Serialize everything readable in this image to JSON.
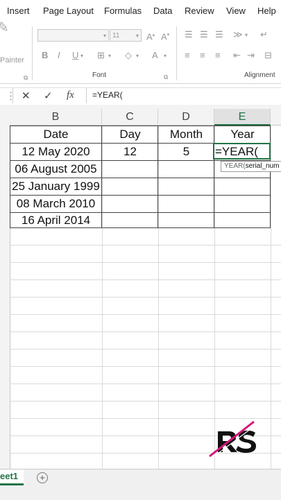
{
  "ribbon": {
    "tabs": [
      "Insert",
      "Page Layout",
      "Formulas",
      "Data",
      "Review",
      "View",
      "Help"
    ],
    "painter_label": "Painter",
    "font_size": "11",
    "group_font": "Font",
    "group_alignment": "Alignment",
    "bold": "B",
    "italic": "I",
    "underline": "U"
  },
  "formula_bar": {
    "cancel_icon": "✕",
    "enter_icon": "✓",
    "fx_label": "fx",
    "content": "=YEAR("
  },
  "columns": [
    {
      "letter": "B",
      "selected": false
    },
    {
      "letter": "C",
      "selected": false
    },
    {
      "letter": "D",
      "selected": false
    },
    {
      "letter": "E",
      "selected": true
    }
  ],
  "table": {
    "headers": [
      "Date",
      "Day",
      "Month",
      "Year"
    ],
    "rows": [
      [
        "12 May 2020",
        "12",
        "5",
        "=YEAR("
      ],
      [
        "06 August 2005",
        "",
        "",
        ""
      ],
      [
        "25 January 1999",
        "",
        "",
        ""
      ],
      [
        "08 March 2010",
        "",
        "",
        ""
      ],
      [
        "16 April 2014",
        "",
        "",
        ""
      ]
    ]
  },
  "tooltip": {
    "fn": "YEAR(",
    "arg": "serial_num"
  },
  "sheet_tab": "eet1",
  "add_sheet": "+",
  "colors": {
    "accent": "#217346",
    "logo_pink": "#d6157b"
  }
}
